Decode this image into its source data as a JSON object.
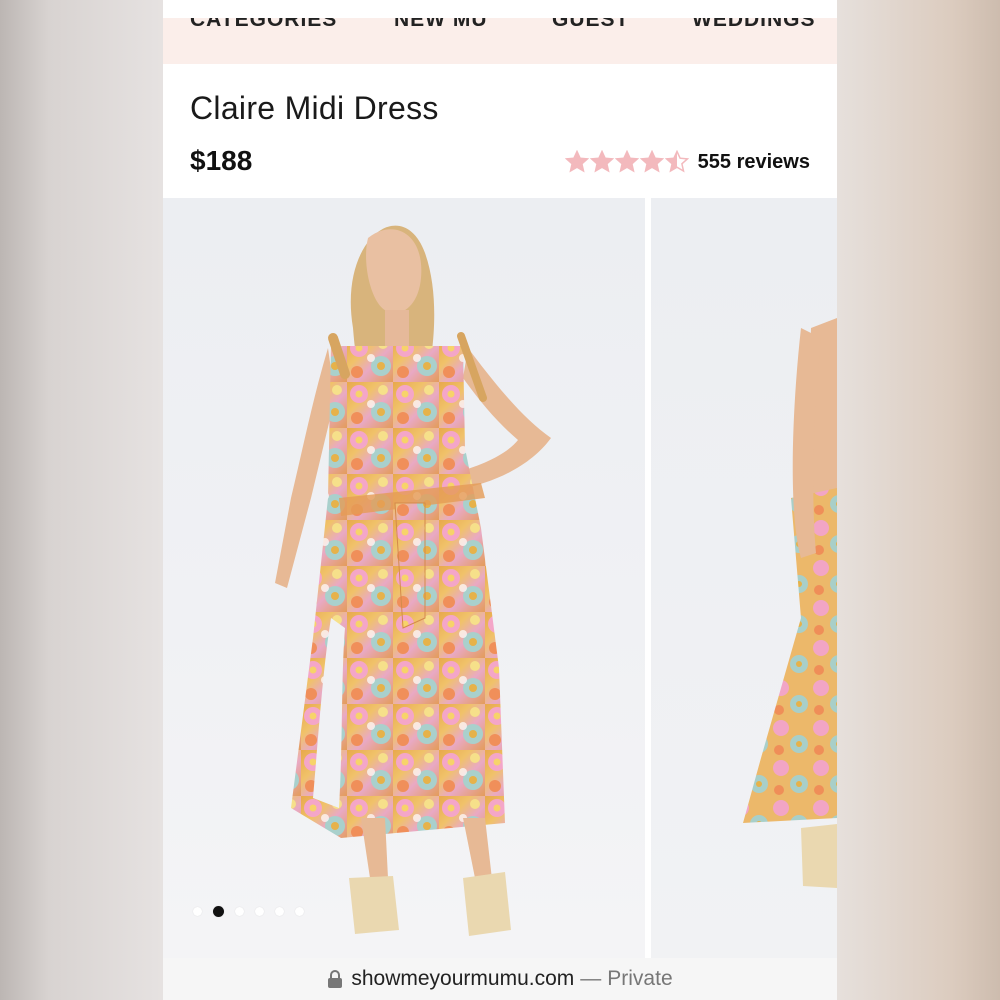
{
  "nav": {
    "items": [
      {
        "label": "CATEGORIES"
      },
      {
        "label": "NEW MU"
      },
      {
        "label": "GUEST"
      },
      {
        "label": "WEDDINGS"
      }
    ]
  },
  "product": {
    "title": "Claire Midi Dress",
    "price": "$188",
    "rating": 4.5,
    "reviews_label": "555 reviews"
  },
  "gallery": {
    "slide_count": 6,
    "active_index": 1
  },
  "browser": {
    "domain": "showmeyourmumu.com",
    "separator": "—",
    "mode": "Private"
  },
  "colors": {
    "star": "#f3b9bd",
    "nav_background": "#fbeeea",
    "text": "#111111"
  }
}
